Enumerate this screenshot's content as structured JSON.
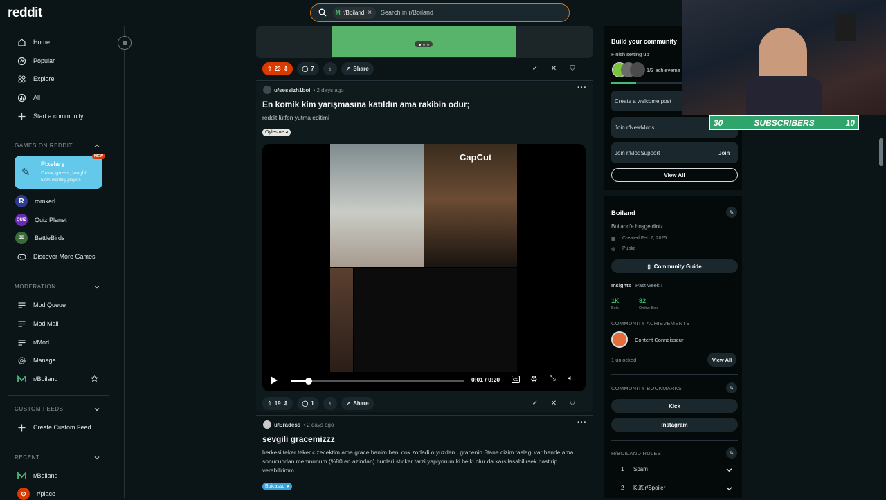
{
  "app": {
    "logo": "reddit"
  },
  "search": {
    "chip": "r/Boiland",
    "chip_letter": "M",
    "placeholder": "Search in r/Boiland"
  },
  "sidebar": {
    "nav": [
      {
        "label": "Home",
        "icon": "home-icon"
      },
      {
        "label": "Popular",
        "icon": "popular-icon"
      },
      {
        "label": "Explore",
        "icon": "explore-icon"
      },
      {
        "label": "All",
        "icon": "all-icon"
      },
      {
        "label": "Start a community",
        "icon": "plus-icon"
      }
    ],
    "games_heading": "GAMES ON REDDIT",
    "pixelary": {
      "title": "Pixelary",
      "subtitle": "Draw, guess, laugh!",
      "players": "529K monthly players",
      "badge": "NEW"
    },
    "games": [
      {
        "label": "romkerl",
        "icon_text": "R",
        "color": "#2f3b8f"
      },
      {
        "label": "Quiz Planet",
        "icon_text": "QUIZ",
        "color": "#6a2bb3"
      },
      {
        "label": "BattleBirds",
        "icon_text": "BB",
        "color": "#3a6b3a"
      },
      {
        "label": "Discover More Games",
        "icon": "gamepad-icon"
      }
    ],
    "moderation_heading": "MODERATION",
    "moderation": [
      {
        "label": "Mod Queue",
        "icon": "queue-icon"
      },
      {
        "label": "Mod Mail",
        "icon": "mail-icon"
      },
      {
        "label": "r/Mod",
        "icon": "mod-icon"
      },
      {
        "label": "Manage",
        "icon": "gear-icon"
      },
      {
        "label": "r/Boiland",
        "icon": "community-icon"
      }
    ],
    "custom_heading": "CUSTOM FEEDS",
    "custom": [
      {
        "label": "Create Custom Feed",
        "icon": "plus-icon"
      }
    ],
    "recent_heading": "RECENT",
    "recent": [
      {
        "label": "r/Boiland",
        "icon": "community-icon"
      },
      {
        "label": "r/place",
        "icon": "place-icon"
      }
    ]
  },
  "posts": [
    {
      "upvotes": "23",
      "comments": "7",
      "share": "Share"
    },
    {
      "author": "u/sessizh1boi",
      "time": "• 2 days ago",
      "title": "En komik kim yarışmasına katıldın ama rakibin odur;",
      "body": "reddit lütfen yutma editimi",
      "flair": "Öylesine",
      "video": {
        "current": "0:01",
        "duration": "0:20",
        "time_label": "0:01 / 0:20",
        "progress": 0.1,
        "watermark": "CapCut"
      },
      "upvotes": "19",
      "comments": "1",
      "share": "Share"
    },
    {
      "author": "u/Eradess",
      "time": "• 2 days ago",
      "title": "sevgili gracemizzz",
      "body": "herkesi teker teker cizecektim ama grace hanim beni cok zorladi o yuzden.. gracenin 5tane cizim taslagi var bende ama sonucundan memnunum (%80 en azindan) bunlari sticker tarzi yapiyorum ki belki olur da karsilasabilirsek bastirip verebilirimm",
      "flair": "Boicasso"
    }
  ],
  "right": {
    "build": {
      "title": "Build your community",
      "subtitle": "Finish setting up",
      "progress_label": "1/3 achieveme",
      "progress": 0.33
    },
    "tasks": [
      {
        "label": "Create a welcome post"
      },
      {
        "label": "Join r/NewMods"
      },
      {
        "label": "Join r/ModSupport",
        "action": "Join"
      }
    ],
    "view_all": "View All",
    "community": {
      "name": "Boiland",
      "description": "Boiland'e hoşgeldiniz",
      "created": "Created Feb 7, 2025",
      "visibility": "Public",
      "guide_button": "Community Guide",
      "insights": "Insights",
      "period": "Past week ›",
      "stats": [
        {
          "value": "1K",
          "label": "Bois"
        },
        {
          "value": "82",
          "label": "Online Bois"
        }
      ],
      "achievements_heading": "COMMUNITY ACHIEVEMENTS",
      "achievement": "Content Connoisseur",
      "unlocked": "1 unlocked",
      "view_all": "View All",
      "bookmarks_heading": "COMMUNITY BOOKMARKS",
      "bookmarks": [
        "Kick",
        "Instagram"
      ],
      "rules_heading": "R/BOILAND RULES",
      "rules": [
        {
          "num": "1",
          "label": "Spam"
        },
        {
          "num": "2",
          "label": "Küfür/Spoiler"
        }
      ]
    }
  },
  "overlay": {
    "sub_left": "30",
    "sub_label": "SUBSCRIBERS",
    "sub_right": "10"
  },
  "colors": {
    "accent": "#d93a00",
    "search_border": "#d9751b",
    "green": "#47b876",
    "bg": "#0b1416"
  }
}
